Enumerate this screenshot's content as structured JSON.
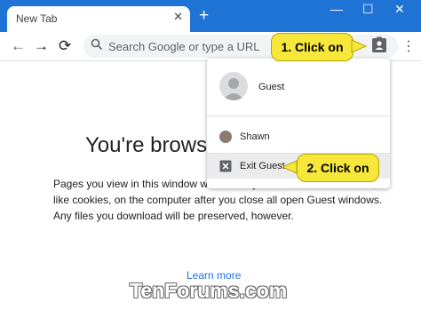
{
  "tab": {
    "title": "New Tab",
    "close": "✕",
    "new_tab": "+"
  },
  "window_controls": {
    "minimize": "—",
    "maximize": "☐",
    "close": "✕"
  },
  "toolbar": {
    "back": "←",
    "forward": "→",
    "reload": "⟳",
    "menu": "⋮"
  },
  "omnibox": {
    "placeholder": "Search Google or type a URL"
  },
  "page": {
    "heading": "You're browsi",
    "body": "Pages you view in this window wo​ and they won't leave other traces, like cookies, on the computer after you close all open Guest windows. Any files you download will be preserved, however.",
    "learn_more": "Learn more"
  },
  "profile_menu": {
    "guest_label": "Guest",
    "profiles": [
      "Shawn"
    ],
    "exit_label": "Exit Guest"
  },
  "callouts": {
    "step1": "1. Click on",
    "step2": "2. Click on"
  },
  "watermark": "TenForums.com",
  "colors": {
    "accent": "#1e73d4",
    "callout": "#f7e73b",
    "link": "#1a73e8"
  }
}
